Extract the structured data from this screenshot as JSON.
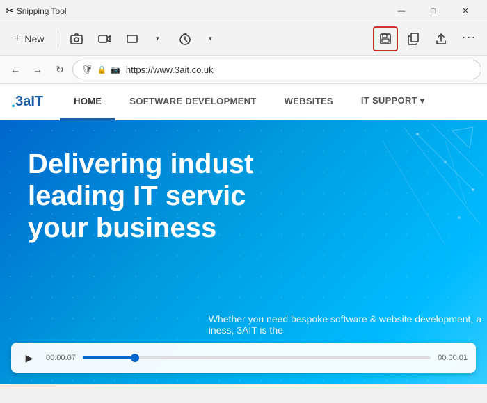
{
  "window": {
    "title": "Snipping Tool",
    "icon": "✂"
  },
  "titlebar": {
    "minimize": "—",
    "maximize": "□",
    "close": "✕"
  },
  "toolbar": {
    "new_label": "New",
    "new_icon": "+",
    "camera_icon": "📷",
    "video_icon": "🎬",
    "rect_icon": "▭",
    "timer_icon": "⏱",
    "timer_arrow": "▾",
    "save_icon": "💾",
    "copy_icon": "⎘",
    "share_icon": "↗",
    "more_icon": "···"
  },
  "browser": {
    "back_icon": "←",
    "forward_icon": "→",
    "refresh_icon": "↻",
    "url": "https://www.3ait.co.uk",
    "lock_icon": "🔒",
    "info_icon": "ℹ",
    "cam_icon": "📷"
  },
  "site": {
    "logo_prefix": ".",
    "logo_name": "3aIT",
    "nav_items": [
      {
        "label": "HOME",
        "active": true
      },
      {
        "label": "SOFTWARE DEVELOPMENT",
        "active": false
      },
      {
        "label": "WEBSITES",
        "active": false
      },
      {
        "label": "IT SUPPORT ▾",
        "active": false
      }
    ]
  },
  "hero": {
    "title_line1": "Delivering indust",
    "title_line2": "leading IT servic",
    "title_line3": "your business",
    "subtitle_partial": "Whether you need bespoke software & website development, a",
    "subtitle_partial2": "iness, 3AIT is the"
  },
  "video": {
    "play_icon": "▶",
    "current_time": "00:00:07",
    "duration": "00:00:01",
    "progress_percent": 15
  }
}
